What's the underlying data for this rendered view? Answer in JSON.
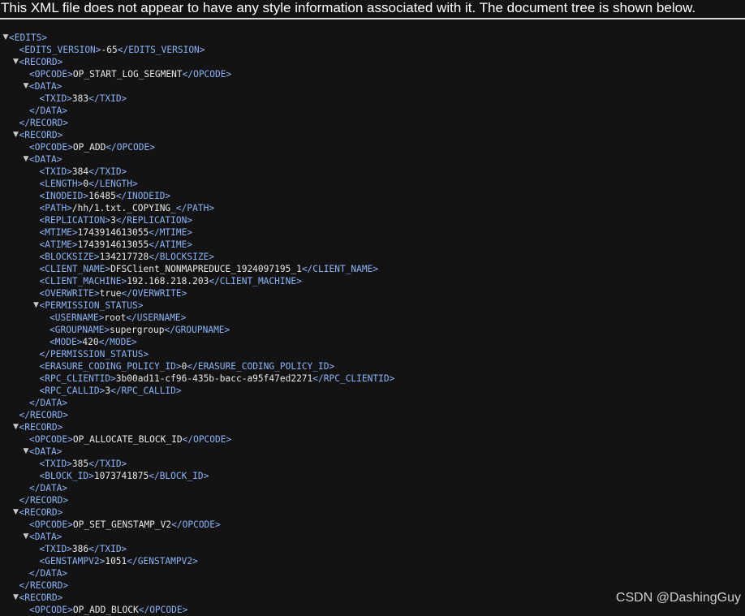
{
  "banner": "This XML file does not appear to have any style information associated with it. The document tree is shown below.",
  "watermark": "CSDN @DashingGuy",
  "colors": {
    "background": "#131313",
    "tag": "#8ab4f8",
    "text": "#e8e8e8"
  },
  "lines": [
    {
      "depth": 0,
      "toggle": true,
      "tag": "<EDITS>",
      "text": "",
      "close": ""
    },
    {
      "depth": 1,
      "toggle": false,
      "tag": "<EDITS_VERSION>",
      "text": "-65",
      "close": "</EDITS_VERSION>"
    },
    {
      "depth": 1,
      "toggle": true,
      "tag": "<RECORD>",
      "text": "",
      "close": ""
    },
    {
      "depth": 2,
      "toggle": false,
      "tag": "<OPCODE>",
      "text": "OP_START_LOG_SEGMENT",
      "close": "</OPCODE>"
    },
    {
      "depth": 2,
      "toggle": true,
      "tag": "<DATA>",
      "text": "",
      "close": ""
    },
    {
      "depth": 3,
      "toggle": false,
      "tag": "<TXID>",
      "text": "383",
      "close": "</TXID>"
    },
    {
      "depth": 2,
      "toggle": false,
      "tag": "</DATA>",
      "text": "",
      "close": ""
    },
    {
      "depth": 1,
      "toggle": false,
      "tag": "</RECORD>",
      "text": "",
      "close": ""
    },
    {
      "depth": 1,
      "toggle": true,
      "tag": "<RECORD>",
      "text": "",
      "close": ""
    },
    {
      "depth": 2,
      "toggle": false,
      "tag": "<OPCODE>",
      "text": "OP_ADD",
      "close": "</OPCODE>"
    },
    {
      "depth": 2,
      "toggle": true,
      "tag": "<DATA>",
      "text": "",
      "close": ""
    },
    {
      "depth": 3,
      "toggle": false,
      "tag": "<TXID>",
      "text": "384",
      "close": "</TXID>"
    },
    {
      "depth": 3,
      "toggle": false,
      "tag": "<LENGTH>",
      "text": "0",
      "close": "</LENGTH>"
    },
    {
      "depth": 3,
      "toggle": false,
      "tag": "<INODEID>",
      "text": "16485",
      "close": "</INODEID>"
    },
    {
      "depth": 3,
      "toggle": false,
      "tag": "<PATH>",
      "text": "/hh/1.txt._COPYING_",
      "close": "</PATH>"
    },
    {
      "depth": 3,
      "toggle": false,
      "tag": "<REPLICATION>",
      "text": "3",
      "close": "</REPLICATION>"
    },
    {
      "depth": 3,
      "toggle": false,
      "tag": "<MTIME>",
      "text": "1743914613055",
      "close": "</MTIME>"
    },
    {
      "depth": 3,
      "toggle": false,
      "tag": "<ATIME>",
      "text": "1743914613055",
      "close": "</ATIME>"
    },
    {
      "depth": 3,
      "toggle": false,
      "tag": "<BLOCKSIZE>",
      "text": "134217728",
      "close": "</BLOCKSIZE>"
    },
    {
      "depth": 3,
      "toggle": false,
      "tag": "<CLIENT_NAME>",
      "text": "DFSClient_NONMAPREDUCE_1924097195_1",
      "close": "</CLIENT_NAME>"
    },
    {
      "depth": 3,
      "toggle": false,
      "tag": "<CLIENT_MACHINE>",
      "text": "192.168.218.203",
      "close": "</CLIENT_MACHINE>"
    },
    {
      "depth": 3,
      "toggle": false,
      "tag": "<OVERWRITE>",
      "text": "true",
      "close": "</OVERWRITE>"
    },
    {
      "depth": 3,
      "toggle": true,
      "tag": "<PERMISSION_STATUS>",
      "text": "",
      "close": ""
    },
    {
      "depth": 4,
      "toggle": false,
      "tag": "<USERNAME>",
      "text": "root",
      "close": "</USERNAME>"
    },
    {
      "depth": 4,
      "toggle": false,
      "tag": "<GROUPNAME>",
      "text": "supergroup",
      "close": "</GROUPNAME>"
    },
    {
      "depth": 4,
      "toggle": false,
      "tag": "<MODE>",
      "text": "420",
      "close": "</MODE>"
    },
    {
      "depth": 3,
      "toggle": false,
      "tag": "</PERMISSION_STATUS>",
      "text": "",
      "close": ""
    },
    {
      "depth": 3,
      "toggle": false,
      "tag": "<ERASURE_CODING_POLICY_ID>",
      "text": "0",
      "close": "</ERASURE_CODING_POLICY_ID>"
    },
    {
      "depth": 3,
      "toggle": false,
      "tag": "<RPC_CLIENTID>",
      "text": "3b00ad11-cf96-435b-bacc-a95f47ed2271",
      "close": "</RPC_CLIENTID>"
    },
    {
      "depth": 3,
      "toggle": false,
      "tag": "<RPC_CALLID>",
      "text": "3",
      "close": "</RPC_CALLID>"
    },
    {
      "depth": 2,
      "toggle": false,
      "tag": "</DATA>",
      "text": "",
      "close": ""
    },
    {
      "depth": 1,
      "toggle": false,
      "tag": "</RECORD>",
      "text": "",
      "close": ""
    },
    {
      "depth": 1,
      "toggle": true,
      "tag": "<RECORD>",
      "text": "",
      "close": ""
    },
    {
      "depth": 2,
      "toggle": false,
      "tag": "<OPCODE>",
      "text": "OP_ALLOCATE_BLOCK_ID",
      "close": "</OPCODE>"
    },
    {
      "depth": 2,
      "toggle": true,
      "tag": "<DATA>",
      "text": "",
      "close": ""
    },
    {
      "depth": 3,
      "toggle": false,
      "tag": "<TXID>",
      "text": "385",
      "close": "</TXID>"
    },
    {
      "depth": 3,
      "toggle": false,
      "tag": "<BLOCK_ID>",
      "text": "1073741875",
      "close": "</BLOCK_ID>"
    },
    {
      "depth": 2,
      "toggle": false,
      "tag": "</DATA>",
      "text": "",
      "close": ""
    },
    {
      "depth": 1,
      "toggle": false,
      "tag": "</RECORD>",
      "text": "",
      "close": ""
    },
    {
      "depth": 1,
      "toggle": true,
      "tag": "<RECORD>",
      "text": "",
      "close": ""
    },
    {
      "depth": 2,
      "toggle": false,
      "tag": "<OPCODE>",
      "text": "OP_SET_GENSTAMP_V2",
      "close": "</OPCODE>"
    },
    {
      "depth": 2,
      "toggle": true,
      "tag": "<DATA>",
      "text": "",
      "close": ""
    },
    {
      "depth": 3,
      "toggle": false,
      "tag": "<TXID>",
      "text": "386",
      "close": "</TXID>"
    },
    {
      "depth": 3,
      "toggle": false,
      "tag": "<GENSTAMPV2>",
      "text": "1051",
      "close": "</GENSTAMPV2>"
    },
    {
      "depth": 2,
      "toggle": false,
      "tag": "</DATA>",
      "text": "",
      "close": ""
    },
    {
      "depth": 1,
      "toggle": false,
      "tag": "</RECORD>",
      "text": "",
      "close": ""
    },
    {
      "depth": 1,
      "toggle": true,
      "tag": "<RECORD>",
      "text": "",
      "close": ""
    },
    {
      "depth": 2,
      "toggle": false,
      "tag": "<OPCODE>",
      "text": "OP_ADD_BLOCK",
      "close": "</OPCODE>"
    }
  ]
}
